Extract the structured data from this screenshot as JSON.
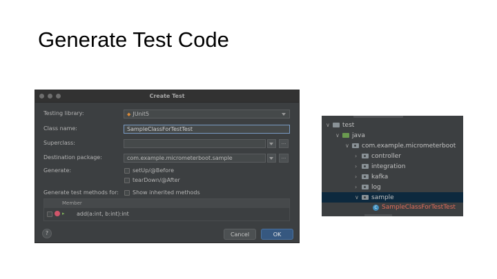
{
  "slide": {
    "title": "Generate Test Code"
  },
  "dialog": {
    "title": "Create Test",
    "testing_library": {
      "label": "Testing library:",
      "value": "JUnit5"
    },
    "class_name": {
      "label": "Class name:",
      "value": "SampleClassForTestTest"
    },
    "superclass": {
      "label": "Superclass:",
      "value": ""
    },
    "destination_package": {
      "label": "Destination package:",
      "value": "com.example.micrometerboot.sample"
    },
    "generate": {
      "label": "Generate:",
      "options": [
        "setUp/@Before",
        "tearDown/@After"
      ]
    },
    "generate_methods": {
      "label": "Generate test methods for:",
      "option": "Show inherited methods"
    },
    "table": {
      "header": "Member",
      "rows": [
        "add(a:int, b:int):int"
      ]
    },
    "buttons": {
      "help": "?",
      "cancel": "Cancel",
      "ok": "OK",
      "more": "..."
    }
  },
  "tree": {
    "items": [
      {
        "label": "test",
        "expanded": true
      },
      {
        "label": "java",
        "expanded": true
      },
      {
        "label": "com.example.micrometerboot",
        "expanded": true
      },
      {
        "label": "controller",
        "expanded": false
      },
      {
        "label": "integration",
        "expanded": false
      },
      {
        "label": "kafka",
        "expanded": false
      },
      {
        "label": "log",
        "expanded": false
      },
      {
        "label": "sample",
        "expanded": true,
        "selected": true
      },
      {
        "label": "SampleClassForTestTest",
        "type": "class"
      }
    ]
  },
  "colors": {
    "dialog_bg": "#3c3f41",
    "ok_button": "#365880",
    "selected_row": "#0d293e",
    "new_class_text": "#e06c5a",
    "source_folder": "#6a9a4f"
  }
}
